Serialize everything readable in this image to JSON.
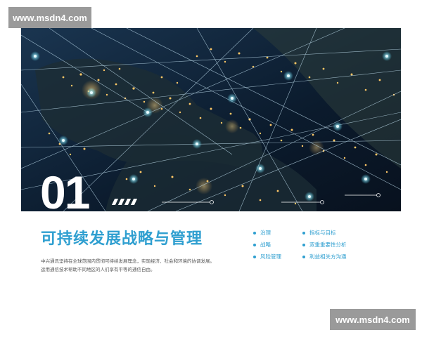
{
  "watermark": {
    "top": "www.msdn4.com",
    "bottom": "www.msdn4.com"
  },
  "hero": {
    "section_number": "01",
    "image_description": "night-time Earth map of Europe and the Mediterranean with glowing city lights connected by a network of lines"
  },
  "section": {
    "title": "可持续发展战略与管理",
    "description_lines": [
      "中兴通讯坚持在全球范围内贯彻可持续发展理念，实现经济、社会和环境的协调发展。",
      "运用通信技术帮助不同地区的人们享有平等的通信自由。"
    ]
  },
  "topics": {
    "left": [
      "治理",
      "战略",
      "风险管理"
    ],
    "right": [
      "指标与目标",
      "双重重要性分析",
      "利益相关方沟通"
    ]
  },
  "colors": {
    "accent": "#2f9fd0",
    "text": "#555555",
    "watermark_bg": "#9a9a9a"
  }
}
